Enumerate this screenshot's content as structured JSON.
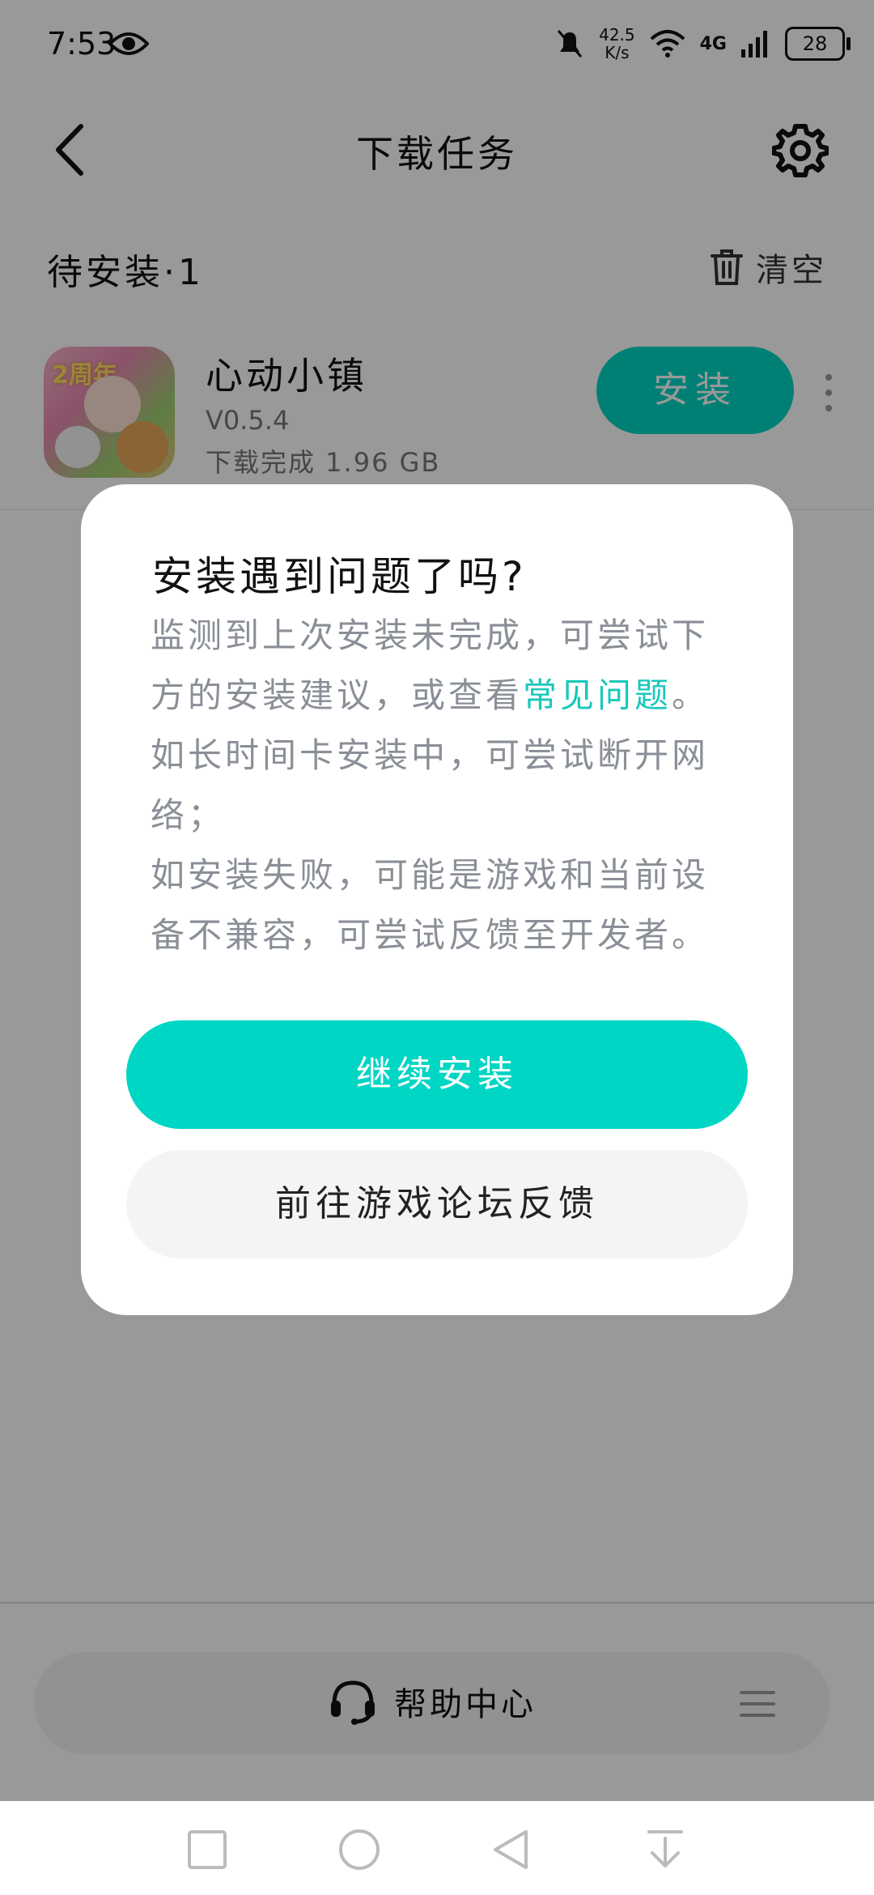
{
  "status_bar": {
    "time": "7:53",
    "speed_value": "42.5",
    "speed_unit": "K/s",
    "network": "4G",
    "battery": "28"
  },
  "header": {
    "title": "下载任务",
    "icons": [
      "back-arrow-icon",
      "gear-icon"
    ]
  },
  "section": {
    "label": "待安装·1",
    "clear_label": "清空"
  },
  "app_item": {
    "name": "心动小镇",
    "version": "V0.5.4",
    "status": "下载完成  1.96 GB",
    "install_label": "安装",
    "icon_badge": "2周年"
  },
  "dialog": {
    "title": "安装遇到问题了吗?",
    "body_line1_prefix": "监测到上次安装未完成，可尝试下方的安装建议，或查看",
    "body_link": "常见问题",
    "body_line1_suffix": "。",
    "body_line2": "如长时间卡安装中，可尝试断开网络；",
    "body_line3": "如安装失败，可能是游戏和当前设备不兼容，可尝试反馈至开发者。",
    "primary_button": "继续安装",
    "secondary_button": "前往游戏论坛反馈"
  },
  "help_bar": {
    "label": "帮助中心"
  },
  "colors": {
    "accent": "#00d6c4",
    "link": "#19c8bb",
    "overlay": "rgba(0,0,0,0.40)"
  }
}
